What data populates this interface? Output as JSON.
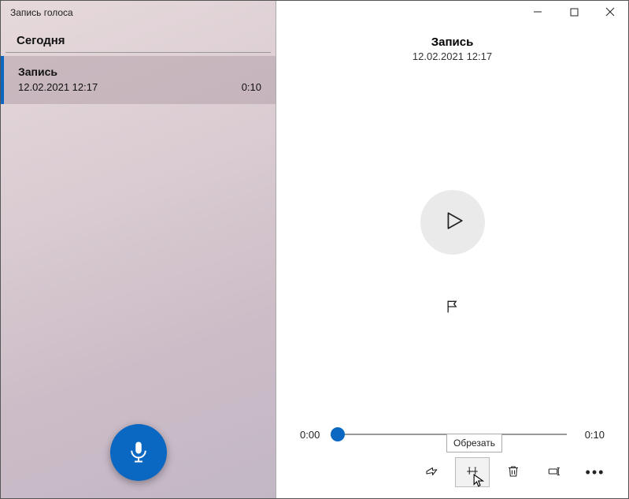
{
  "app_title": "Запись голоса",
  "sidebar": {
    "section": "Сегодня",
    "items": [
      {
        "name": "Запись",
        "date": "12.02.2021 12:17",
        "duration": "0:10"
      }
    ]
  },
  "detail": {
    "title": "Запись",
    "subtitle": "12.02.2021 12:17"
  },
  "timeline": {
    "current": "0:00",
    "total": "0:10"
  },
  "tooltip": "Обрезать"
}
